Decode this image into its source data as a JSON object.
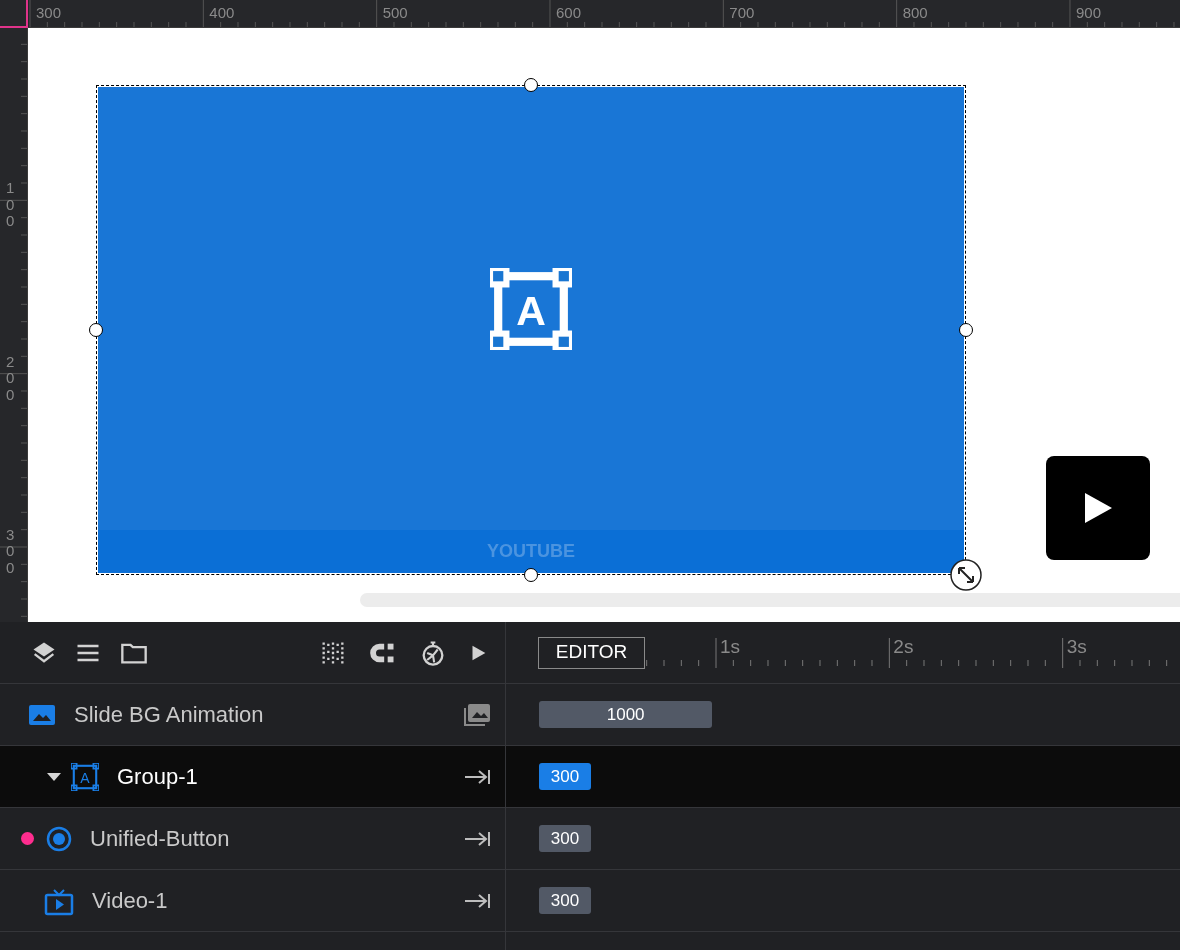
{
  "rulers": {
    "horizontal": [
      "300",
      "400",
      "500",
      "600",
      "700",
      "800",
      "900"
    ],
    "vertical": [
      "100",
      "200",
      "300"
    ]
  },
  "canvas": {
    "element": {
      "kind": "group",
      "icon_letter": "A",
      "caption": "YOUTUBE",
      "selected": true
    },
    "play_button": {
      "kind": "play"
    }
  },
  "timeline": {
    "mode_button": "EDITOR",
    "time_labels": [
      "1s",
      "2s",
      "3s"
    ]
  },
  "layers": [
    {
      "name": "Slide BG Animation",
      "kind": "background",
      "duration": "1000",
      "selected": false,
      "flagged": false
    },
    {
      "name": "Group-1",
      "kind": "group",
      "icon_letter": "A",
      "expanded": true,
      "duration": "300",
      "selected": true,
      "flagged": false
    },
    {
      "name": "Unified-Button",
      "kind": "button",
      "duration": "300",
      "selected": false,
      "flagged": true
    },
    {
      "name": "Video-1",
      "kind": "video",
      "duration": "300",
      "selected": false,
      "flagged": false
    }
  ]
}
